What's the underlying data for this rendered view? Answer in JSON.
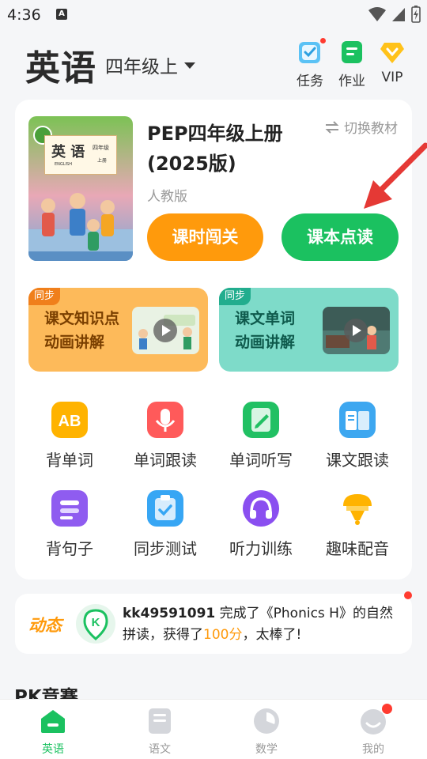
{
  "status_bar": {
    "time": "4:36",
    "notif_letter": "A"
  },
  "header": {
    "subject": "英语",
    "grade": "四年级上",
    "actions": [
      {
        "label": "任务",
        "icon": "task-check-icon"
      },
      {
        "label": "作业",
        "icon": "homework-icon"
      },
      {
        "label": "VIP",
        "icon": "vip-diamond-icon"
      }
    ]
  },
  "book": {
    "cover_title": "英 语",
    "cover_sub": "ENGLISH",
    "cover_grade": "四年级",
    "cover_vol": "上册",
    "title": "PEP四年级上册(2025版)",
    "publisher": "人教版",
    "switch_label": "切换教材"
  },
  "buttons": {
    "lesson_challenge": "课时闯关",
    "textbook_reading": "课本点读"
  },
  "promos": [
    {
      "tag": "同步",
      "line1": "课文知识点",
      "line2": "动画讲解"
    },
    {
      "tag": "同步",
      "line1": "课文单词",
      "line2": "动画讲解"
    }
  ],
  "features": [
    {
      "label": "背单词",
      "icon": "ab-words-icon",
      "color": "#ffb300"
    },
    {
      "label": "单词跟读",
      "icon": "microphone-icon",
      "color": "#ff5a5a"
    },
    {
      "label": "单词听写",
      "icon": "pen-write-icon",
      "color": "#21c063"
    },
    {
      "label": "课文跟读",
      "icon": "open-book-icon",
      "color": "#3da7f0"
    },
    {
      "label": "背句子",
      "icon": "sentence-list-icon",
      "color": "#8f5cf0"
    },
    {
      "label": "同步测试",
      "icon": "clipboard-check-icon",
      "color": "#37a6f4"
    },
    {
      "label": "听力训练",
      "icon": "headphones-icon",
      "color": "#8a4ff0"
    },
    {
      "label": "趣味配音",
      "icon": "dubbing-icon",
      "color": "#ffb300"
    }
  ],
  "activity": {
    "label": "动态",
    "user": "kk49591091",
    "text_before": " 完成了《Phonics H》的自然拼读，获得了",
    "score": "100分",
    "text_after": "，太棒了!"
  },
  "section": {
    "title": "PK竞赛"
  },
  "nav": [
    {
      "label": "英语",
      "icon": "home-icon",
      "active": true
    },
    {
      "label": "语文",
      "icon": "chinese-book-icon",
      "active": false
    },
    {
      "label": "数学",
      "icon": "math-pie-icon",
      "active": false
    },
    {
      "label": "我的",
      "icon": "profile-face-icon",
      "active": false
    }
  ]
}
